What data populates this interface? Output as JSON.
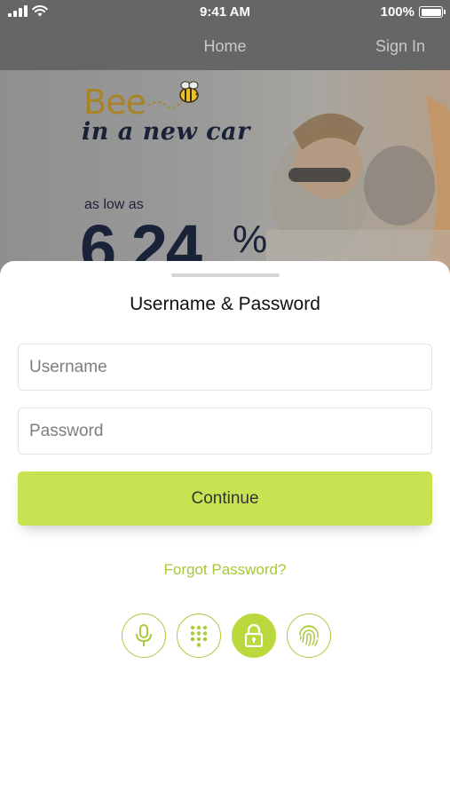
{
  "status_bar": {
    "time": "9:41 AM",
    "battery": "100%",
    "battery_level": 1.0
  },
  "nav": {
    "title": "Home",
    "sign_in": "Sign In"
  },
  "banner": {
    "brand": "Bee",
    "tagline": "in a new car",
    "rate_prefix": "as low as",
    "rate_value": "6.24",
    "rate_suffix": "%"
  },
  "sheet": {
    "title": "Username & Password",
    "username_placeholder": "Username",
    "password_placeholder": "Password",
    "continue_label": "Continue",
    "forgot_label": "Forgot Password?"
  },
  "auth_methods": [
    {
      "name": "microphone-icon",
      "active": false
    },
    {
      "name": "keypad-icon",
      "active": false
    },
    {
      "name": "lock-icon",
      "active": true
    },
    {
      "name": "fingerprint-icon",
      "active": false
    }
  ],
  "colors": {
    "accent": "#c8e352",
    "accent_text": "#a6c935",
    "header": "#666666",
    "navy": "#1a2238",
    "gold": "#a88427"
  }
}
